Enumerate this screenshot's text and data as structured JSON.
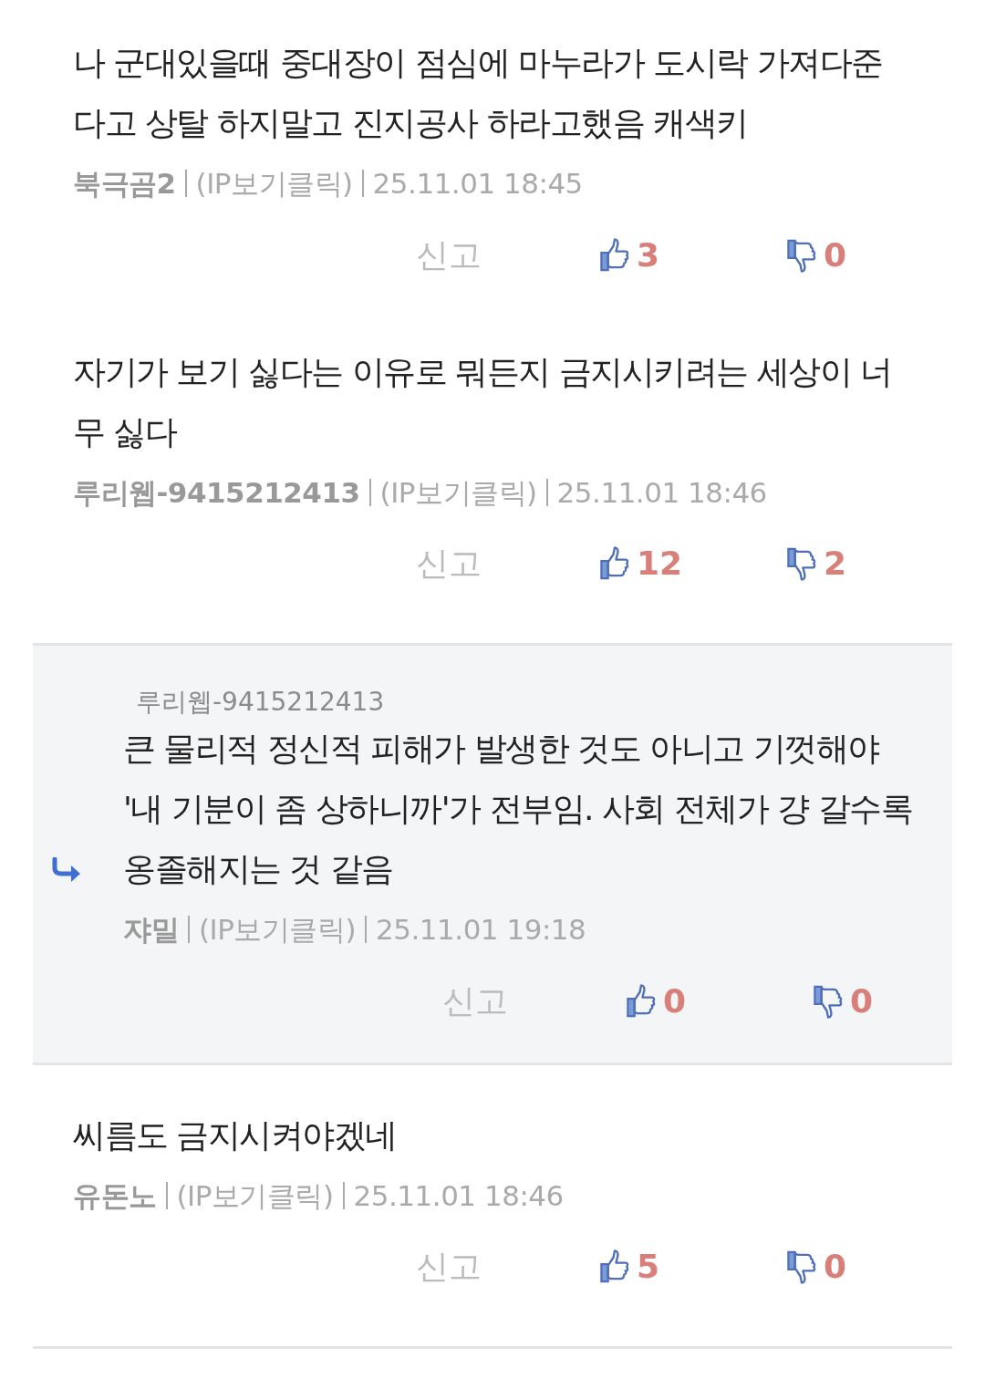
{
  "comments": [
    {
      "kind": "comment",
      "text": "나 군대있을때 중대장이 점심에 마누라가 도시락 가져다준다고 상탈 하지말고 진지공사 하라고했음 캐색키",
      "author": "북극곰2",
      "ip": "(IP보기클릭)",
      "date": "25.11.01 18:45",
      "report": "신고",
      "likes": "3",
      "dislikes": "0"
    },
    {
      "kind": "comment",
      "text": "자기가 보기 싫다는 이유로 뭐든지 금지시키려는 세상이 너무 싫다",
      "author": "루리웹-9415212413",
      "ip": "(IP보기클릭)",
      "date": "25.11.01 18:46",
      "report": "신고",
      "likes": "12",
      "dislikes": "2"
    },
    {
      "kind": "reply",
      "reply_to": "루리웹-9415212413",
      "text": "큰 물리적 정신적 피해가 발생한 것도 아니고 기껏해야 '내 기분이 좀 상하니까'가 전부임. 사회 전체가 걍 갈수록 옹졸해지는 것 같음",
      "author": "쟈밀",
      "ip": "(IP보기클릭)",
      "date": "25.11.01 19:18",
      "report": "신고",
      "likes": "0",
      "dislikes": "0"
    },
    {
      "kind": "comment",
      "text": "씨름도 금지시켜야겠네",
      "author": "유돈노",
      "ip": "(IP보기클릭)",
      "date": "25.11.01 18:46",
      "report": "신고",
      "likes": "5",
      "dislikes": "0"
    }
  ]
}
